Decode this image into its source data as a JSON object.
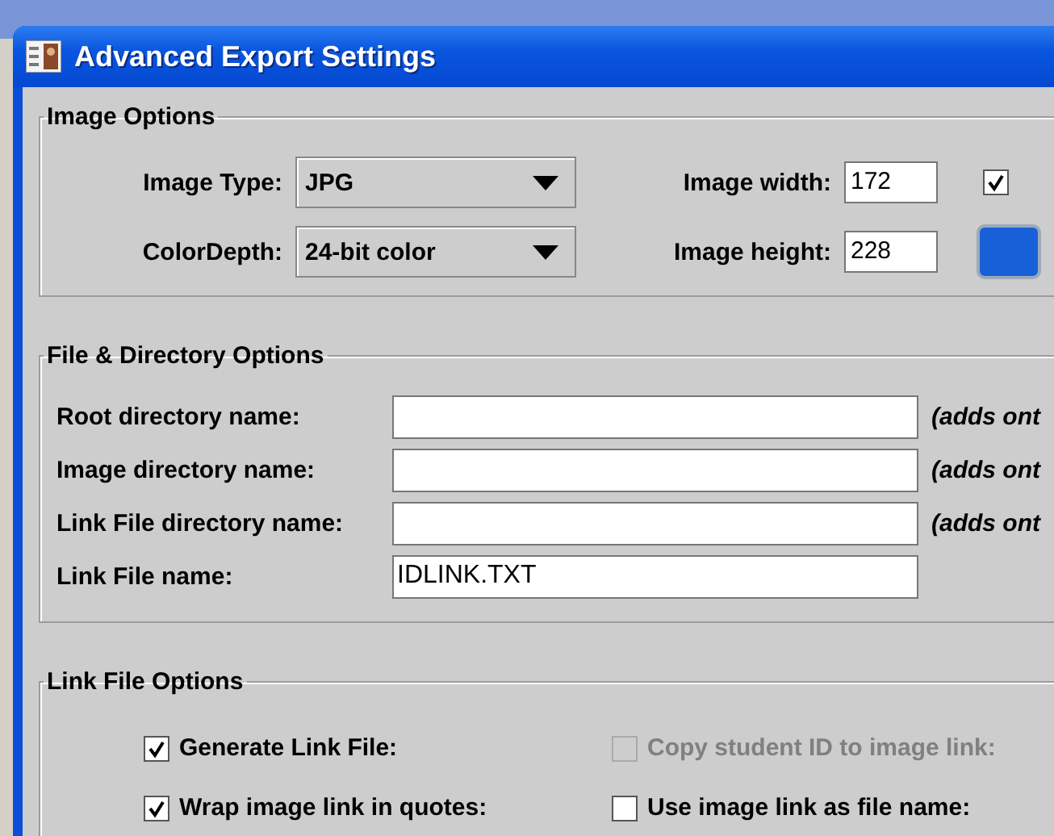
{
  "window": {
    "title": "Advanced Export Settings"
  },
  "image_options": {
    "title": "Image Options",
    "image_type": {
      "label": "Image Type:",
      "value": "JPG"
    },
    "color_depth": {
      "label": "ColorDepth:",
      "value": "24-bit color"
    },
    "image_width": {
      "label": "Image width:",
      "value": "172"
    },
    "image_height": {
      "label": "Image height:",
      "value": "228"
    },
    "side_checkbox": {
      "checked": true
    }
  },
  "file_directory_options": {
    "title": "File & Directory Options",
    "rows": [
      {
        "label": "Root directory name:",
        "value": "",
        "note": "(adds ont"
      },
      {
        "label": "Image directory name:",
        "value": "",
        "note": "(adds ont"
      },
      {
        "label": "Link File directory name:",
        "value": "",
        "note": "(adds ont"
      },
      {
        "label": "Link File name:",
        "value": "IDLINK.TXT"
      }
    ]
  },
  "link_file_options": {
    "title": "Link File Options",
    "checkboxes": [
      {
        "label": "Generate Link File:",
        "checked": true,
        "disabled": false
      },
      {
        "label": "Copy student ID to image link:",
        "checked": false,
        "disabled": true
      },
      {
        "label": "Wrap image link in quotes:",
        "checked": true,
        "disabled": false
      },
      {
        "label": "Use image link as file name:",
        "checked": false,
        "disabled": false
      }
    ]
  }
}
